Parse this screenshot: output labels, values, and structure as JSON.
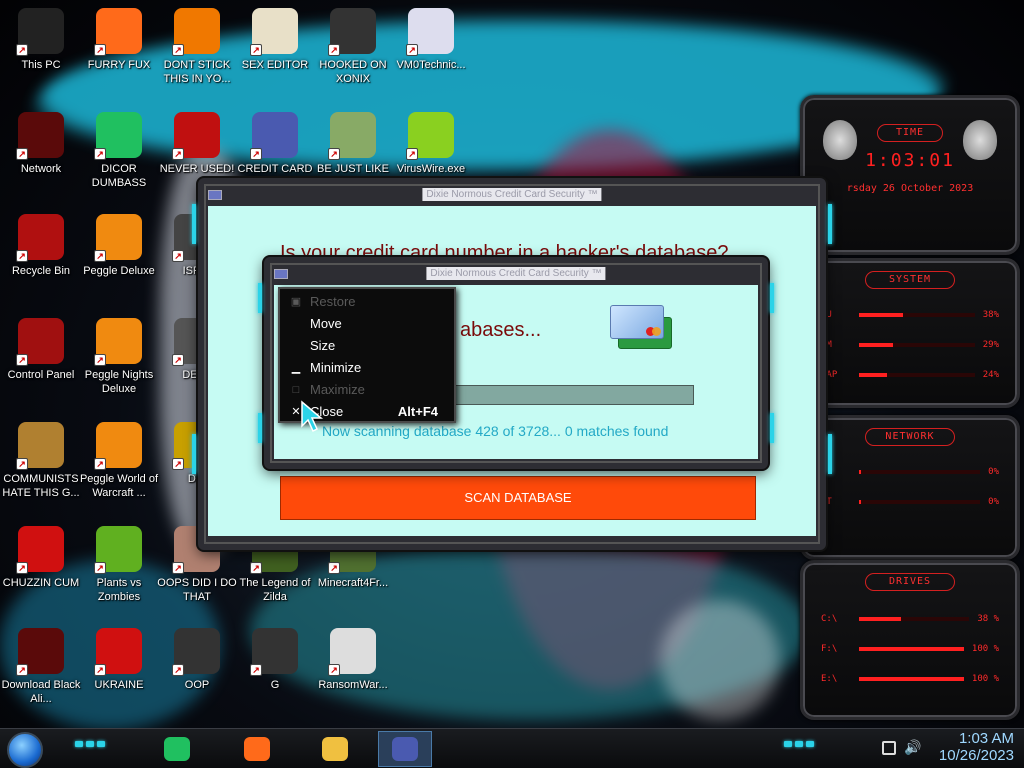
{
  "desktop": {
    "icons": [
      {
        "label": "This PC",
        "icon": "computer-icon",
        "color": "#222"
      },
      {
        "label": "FURRY FUX",
        "icon": "firefox-icon",
        "color": "#ff6a1a"
      },
      {
        "label": "DONT STICK THIS IN YO...",
        "icon": "vlc-cone-icon",
        "color": "#f07800"
      },
      {
        "label": "SEX EDITOR",
        "icon": "hxd-editor-icon",
        "color": "#e8e0c8"
      },
      {
        "label": "HOOKED ON XONIX",
        "icon": "xonix-game-icon",
        "color": "#333"
      },
      {
        "label": "VM0Technic...",
        "icon": "doctor-icon",
        "color": "#dde"
      },
      {
        "label": "Network",
        "icon": "alien-network-icon",
        "color": "#5a0a0a"
      },
      {
        "label": "DICOR DUMBASS",
        "icon": "discord-like-icon",
        "color": "#20c060"
      },
      {
        "label": "NEVER USED!",
        "icon": "devcpp-icon",
        "color": "#c01010"
      },
      {
        "label": "CREDIT CARD",
        "icon": "credit-card-icon",
        "color": "#4a5ab0"
      },
      {
        "label": "BE JUST LIKE",
        "icon": "elf-avatar-icon",
        "color": "#8a6"
      },
      {
        "label": "VirusWire.exe",
        "icon": "lime-icon",
        "color": "#8ad020"
      },
      {
        "label": "Recycle Bin",
        "icon": "recycle-bin-icon",
        "color": "#b01010"
      },
      {
        "label": "Peggle Deluxe",
        "icon": "peggle-icon",
        "color": "#f08a10"
      },
      {
        "label": "ISRAI",
        "icon": "app-icon",
        "color": "#444"
      },
      {
        "label": "Control Panel",
        "icon": "control-panel-icon",
        "color": "#a01010"
      },
      {
        "label": "Peggle Nights Deluxe",
        "icon": "peggle-nights-icon",
        "color": "#f08a10"
      },
      {
        "label": "DEEZ",
        "icon": "app-icon",
        "color": "#555"
      },
      {
        "label": "COMMUNISTS HATE THIS G...",
        "icon": "money-bag-icon",
        "color": "#b08030"
      },
      {
        "label": "Peggle World of Warcraft ...",
        "icon": "peggle-wow-icon",
        "color": "#f08a10"
      },
      {
        "label": "DIE",
        "icon": "app-icon",
        "color": "#c8a000"
      },
      {
        "label": "CHUZZIN CUM",
        "icon": "chuzzle-icon",
        "color": "#d01010"
      },
      {
        "label": "Plants vs Zombies",
        "icon": "pvz-icon",
        "color": "#60b020"
      },
      {
        "label": "OOPS DID I DO THAT",
        "icon": "face-icon",
        "color": "#b08070"
      },
      {
        "label": "The Legend of Zilda",
        "icon": "zelda-icon",
        "color": "#406020"
      },
      {
        "label": "Minecraft4Fr...",
        "icon": "minecraft-icon",
        "color": "#507030"
      },
      {
        "label": "Download Black Ali...",
        "icon": "alien-icon",
        "color": "#5a0a0a"
      },
      {
        "label": "UKRAINE",
        "icon": "radiation-icon",
        "color": "#d01010"
      },
      {
        "label": "OOP",
        "icon": "app-icon",
        "color": "#333"
      },
      {
        "label": "G",
        "icon": "app-icon",
        "color": "#333"
      },
      {
        "label": "RansomWar...",
        "icon": "skull-icon",
        "color": "#ddd"
      }
    ]
  },
  "gadgets": {
    "time": {
      "title": "TIME",
      "clock": "1:03:01",
      "date": "rsday 26 October 2023"
    },
    "system": {
      "title": "SYSTEM",
      "rows": [
        {
          "label": "PU",
          "value": "38%",
          "level": 0.38
        },
        {
          "label": "AM",
          "value": "29%",
          "level": 0.29
        },
        {
          "label": "WAP",
          "value": "24%",
          "level": 0.24
        }
      ]
    },
    "network": {
      "title": "NETWORK",
      "rows": [
        {
          "label": "",
          "value": "0%"
        },
        {
          "label": "UT",
          "value": "0%"
        }
      ]
    },
    "drives": {
      "title": "DRIVES",
      "rows": [
        {
          "label": "C:\\",
          "value": "38 %",
          "level": 0.38
        },
        {
          "label": "F:\\",
          "value": "100 %",
          "level": 1.0
        },
        {
          "label": "E:\\",
          "value": "100 %",
          "level": 1.0
        }
      ]
    }
  },
  "back_window": {
    "title": "Dixie Normous Credit Card Security ™",
    "headline": "Is your credit card number in a hacker's database?",
    "scan_button": "SCAN DATABASE"
  },
  "front_window": {
    "title": "Dixie Normous Credit Card Security ™",
    "heading_partial": "abases...",
    "progress": 0.115,
    "status": "Now scanning database 428 of 3728...  0 matches found"
  },
  "system_menu": {
    "items": [
      {
        "label": "Restore",
        "icon": "restore-icon",
        "glyph": "▣",
        "disabled": true,
        "accel": ""
      },
      {
        "label": "Move",
        "icon": "",
        "glyph": "",
        "disabled": false,
        "accel": ""
      },
      {
        "label": "Size",
        "icon": "",
        "glyph": "",
        "disabled": false,
        "accel": ""
      },
      {
        "label": "Minimize",
        "icon": "minimize-icon",
        "glyph": "▁",
        "disabled": false,
        "accel": ""
      },
      {
        "label": "Maximize",
        "icon": "maximize-icon",
        "glyph": "□",
        "disabled": true,
        "accel": ""
      },
      {
        "label": "Close",
        "icon": "close-icon",
        "glyph": "✕",
        "disabled": false,
        "accel": "Alt+F4"
      }
    ]
  },
  "taskbar": {
    "apps": [
      {
        "name": "chat-app",
        "icon": "chat-icon",
        "color": "#20c060"
      },
      {
        "name": "firefox",
        "icon": "firefox-icon",
        "color": "#ff6a1a"
      },
      {
        "name": "file-explorer",
        "icon": "folder-icon",
        "color": "#f0c040"
      },
      {
        "name": "credit-card-app",
        "icon": "credit-card-icon",
        "color": "#4a5ab0"
      }
    ],
    "time": "1:03 AM",
    "date": "10/26/2023"
  }
}
